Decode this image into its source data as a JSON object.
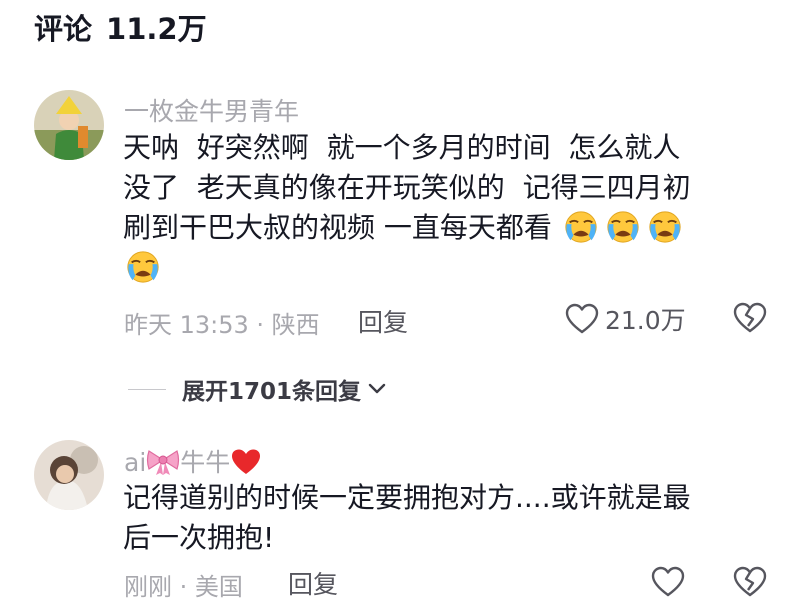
{
  "header": {
    "label": "评论",
    "count": "11.2万"
  },
  "comments": [
    {
      "username": "一枚金牛男青年",
      "lines": [
        "天呐  好突然啊  就一个多月的时间  怎么就人",
        "没了  老天真的像在开玩笑似的  记得三四月初",
        "刷到干巴大叔的视频 一直每天都看"
      ],
      "emoji_name": "loudly-crying-face",
      "meta": "昨天 13:53 · 陕西",
      "reply_label": "回复",
      "like_count": "21.0万"
    },
    {
      "username_prefix": "ai",
      "username_suffix": "牛牛",
      "username_emojis": [
        "ribbon-bow",
        "red-heart"
      ],
      "lines": [
        "记得道别的时候一定要拥抱对方....或许就是最",
        "后一次拥抱!"
      ],
      "meta": "刚刚 · 美国",
      "reply_label": "回复"
    }
  ],
  "expand": {
    "label": "展开1701条回复"
  },
  "colors": {
    "primary_text": "#161823",
    "secondary_text": "#a8a8ae",
    "action_text": "#56565e",
    "emoji_yellow": "#ffc83d",
    "tear_blue": "#4fb3f6"
  }
}
